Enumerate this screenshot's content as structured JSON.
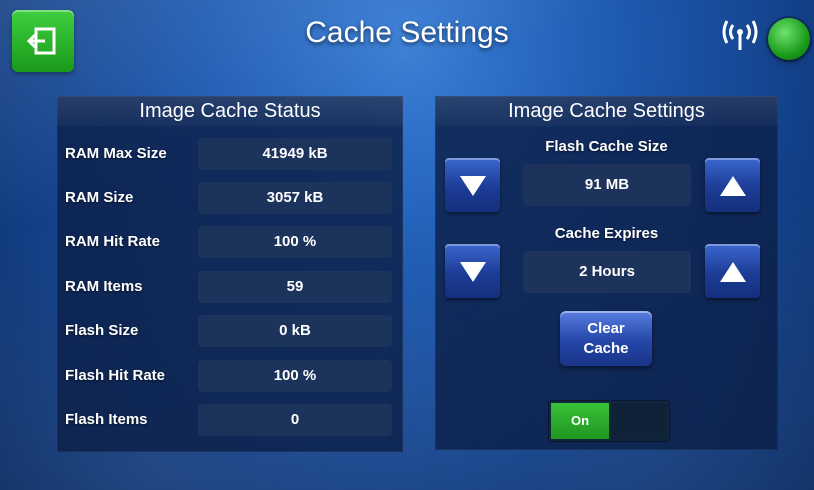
{
  "header": {
    "title": "Cache Settings",
    "exit_icon": "exit-icon",
    "signal_icon": "wireless-signal-icon",
    "status_indicator_color": "#2fb82f"
  },
  "status_panel": {
    "title": "Image Cache Status",
    "rows": [
      {
        "label": "RAM Max Size",
        "value": "41949 kB"
      },
      {
        "label": "RAM Size",
        "value": "3057 kB"
      },
      {
        "label": "RAM Hit Rate",
        "value": "100 %"
      },
      {
        "label": "RAM Items",
        "value": "59"
      },
      {
        "label": "Flash Size",
        "value": "0 kB"
      },
      {
        "label": "Flash Hit Rate",
        "value": "100 %"
      },
      {
        "label": "Flash Items",
        "value": "0"
      }
    ]
  },
  "settings_panel": {
    "title": "Image Cache Settings",
    "flash_cache_size": {
      "label": "Flash Cache Size",
      "value": "91 MB"
    },
    "cache_expires": {
      "label": "Cache Expires",
      "value": "2 Hours"
    },
    "clear_cache": {
      "line1": "Clear",
      "line2": "Cache"
    },
    "toggle": {
      "label": "On",
      "state": "on"
    }
  },
  "colors": {
    "accent_green": "#2fb82f",
    "button_blue": "#1c3c96",
    "panel_bg": "#0c2048"
  }
}
